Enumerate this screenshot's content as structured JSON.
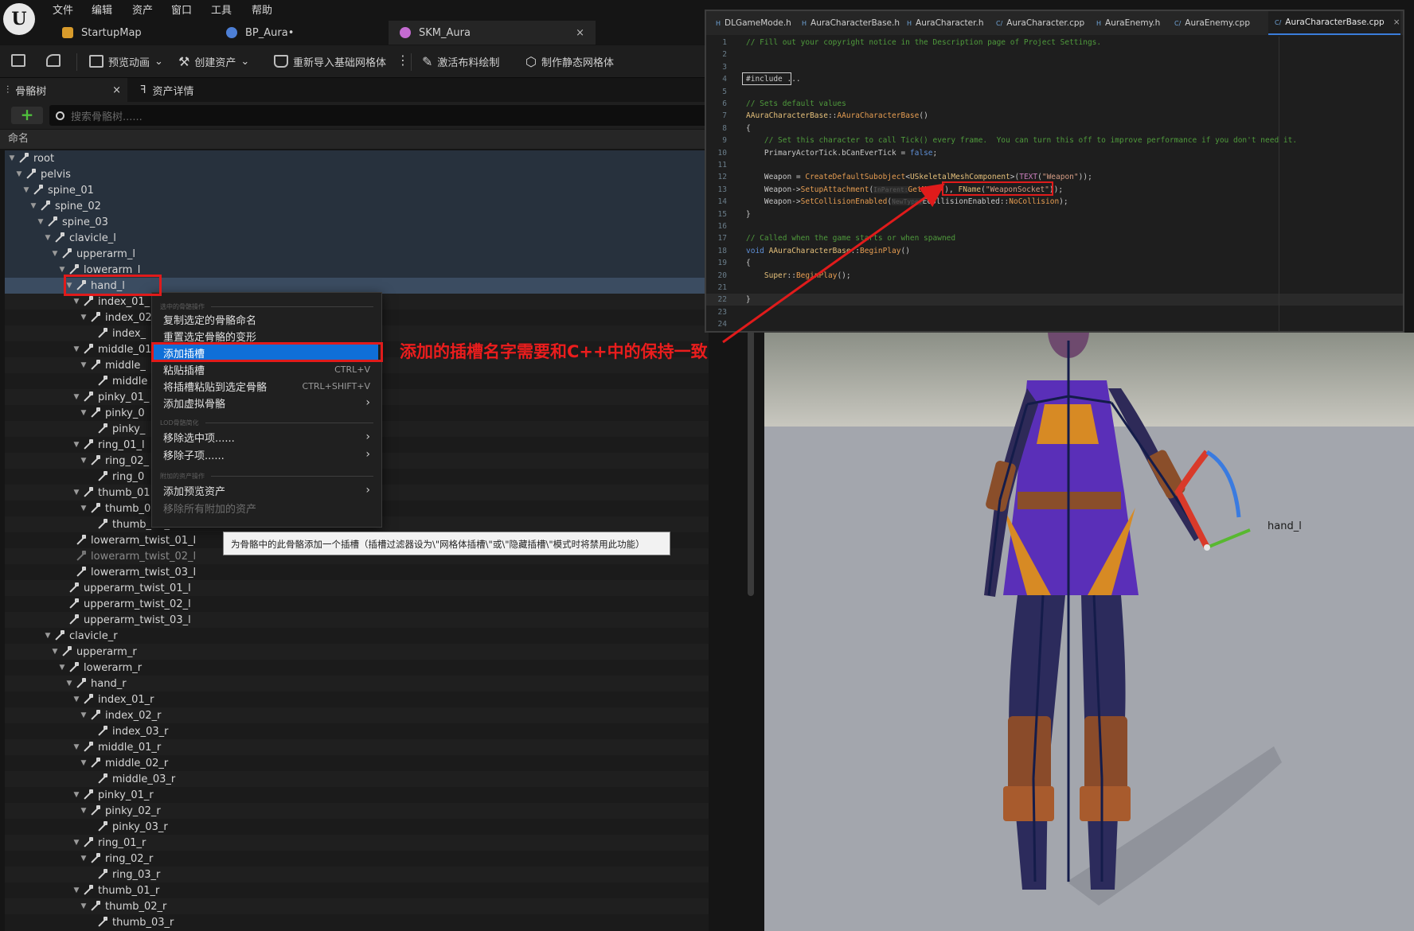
{
  "menu": [
    "文件",
    "编辑",
    "资产",
    "窗口",
    "工具",
    "帮助"
  ],
  "doc_tabs": [
    {
      "label": "StartupMap",
      "color": "#d89b2b"
    },
    {
      "label": "BP_Aura•",
      "color": "#4d7fd6"
    },
    {
      "label": "SKM_Aura",
      "color": "#c46bd1",
      "close": "×"
    }
  ],
  "toolbar": {
    "preview_animation": "预览动画",
    "create_asset": "创建资产",
    "reimport_base_mesh": "重新导入基础网格体",
    "activate_cloth_paint": "激活布料绘制",
    "make_static_mesh": "制作静态网格体"
  },
  "panel": {
    "tab_skeleton_tree": "骨骼树",
    "tab_asset_details": "资产详情",
    "tab_close": "×",
    "add_label": "+",
    "search_placeholder": "搜索骨骼树......",
    "column_header": "命名"
  },
  "tree": [
    {
      "label": "root",
      "tri": "▼"
    },
    {
      "label": "pelvis",
      "tri": "▼"
    },
    {
      "label": "spine_01",
      "tri": "▼"
    },
    {
      "label": "spine_02",
      "tri": "▼"
    },
    {
      "label": "spine_03",
      "tri": "▼"
    },
    {
      "label": "clavicle_l",
      "tri": "▼"
    },
    {
      "label": "upperarm_l",
      "tri": "▼"
    },
    {
      "label": "lowerarm_l",
      "tri": "▼"
    },
    {
      "label": "hand_l",
      "tri": "▼"
    },
    {
      "label": "index_01_",
      "tri": "▼"
    },
    {
      "label": "index_02",
      "tri": "▼"
    },
    {
      "label": "index_",
      "tri": ""
    },
    {
      "label": "middle_01",
      "tri": "▼"
    },
    {
      "label": "middle_",
      "tri": "▼"
    },
    {
      "label": "middle",
      "tri": ""
    },
    {
      "label": "pinky_01_",
      "tri": "▼"
    },
    {
      "label": "pinky_0",
      "tri": "▼"
    },
    {
      "label": "pinky_",
      "tri": ""
    },
    {
      "label": "ring_01_l",
      "tri": "▼"
    },
    {
      "label": "ring_02_",
      "tri": "▼"
    },
    {
      "label": "ring_0",
      "tri": ""
    },
    {
      "label": "thumb_01",
      "tri": "▼"
    },
    {
      "label": "thumb_0",
      "tri": "▼"
    },
    {
      "label": "thumb_03_",
      "tri": ""
    },
    {
      "label": "lowerarm_twist_01_l",
      "tri": ""
    },
    {
      "label": "lowerarm_twist_02_l",
      "tri": ""
    },
    {
      "label": "lowerarm_twist_03_l",
      "tri": ""
    },
    {
      "label": "upperarm_twist_01_l",
      "tri": ""
    },
    {
      "label": "upperarm_twist_02_l",
      "tri": ""
    },
    {
      "label": "upperarm_twist_03_l",
      "tri": ""
    },
    {
      "label": "clavicle_r",
      "tri": "▼"
    },
    {
      "label": "upperarm_r",
      "tri": "▼"
    },
    {
      "label": "lowerarm_r",
      "tri": "▼"
    },
    {
      "label": "hand_r",
      "tri": "▼"
    },
    {
      "label": "index_01_r",
      "tri": "▼"
    },
    {
      "label": "index_02_r",
      "tri": "▼"
    },
    {
      "label": "index_03_r",
      "tri": ""
    },
    {
      "label": "middle_01_r",
      "tri": "▼"
    },
    {
      "label": "middle_02_r",
      "tri": "▼"
    },
    {
      "label": "middle_03_r",
      "tri": ""
    },
    {
      "label": "pinky_01_r",
      "tri": "▼"
    },
    {
      "label": "pinky_02_r",
      "tri": "▼"
    },
    {
      "label": "pinky_03_r",
      "tri": ""
    },
    {
      "label": "ring_01_r",
      "tri": "▼"
    },
    {
      "label": "ring_02_r",
      "tri": "▼"
    },
    {
      "label": "ring_03_r",
      "tri": ""
    },
    {
      "label": "thumb_01_r",
      "tri": "▼"
    },
    {
      "label": "thumb_02_r",
      "tri": "▼"
    },
    {
      "label": "thumb_03_r",
      "tri": ""
    }
  ],
  "context_menu": {
    "section_selected": "选中的骨骼操作",
    "copy_bone_names": "复制选定的骨骼命名",
    "reset_transforms": "重置选定骨骼的变形",
    "add_socket": "添加插槽",
    "paste_socket": "粘贴插槽",
    "paste_socket_shortcut": "CTRL+V",
    "paste_socket_to_bone": "将插槽粘贴到选定骨骼",
    "paste_socket_to_bone_shortcut": "CTRL+SHIFT+V",
    "add_virtual_bone": "添加虚拟骨骼",
    "section_lod": "LOD骨骼简化",
    "remove_selected": "移除选中项......",
    "remove_children": "移除子项......",
    "section_attached": "附加的资产操作",
    "add_preview_asset": "添加预览资产",
    "remove_all_attached": "移除所有附加的资产",
    "arrow": "›"
  },
  "tooltip": "为骨骼中的此骨骼添加一个插槽（插槽过滤器设为\\\"网格体插槽\\\"或\\\"隐藏插槽\\\"模式时将禁用此功能）",
  "annotation": "添加的插槽名字需要和C++中的保持一致",
  "editor": {
    "tabs": [
      {
        "label": "DLGameMode.h",
        "ext": "H"
      },
      {
        "label": "AuraCharacterBase.h",
        "ext": "H"
      },
      {
        "label": "AuraCharacter.h",
        "ext": "H"
      },
      {
        "label": "AuraCharacter.cpp",
        "ext": "C/"
      },
      {
        "label": "AuraEnemy.h",
        "ext": "H"
      },
      {
        "label": "AuraEnemy.cpp",
        "ext": "C/"
      },
      {
        "label": "AuraCharacterBase.cpp",
        "ext": "C/",
        "close": "×"
      }
    ],
    "lines": [
      {
        "n": "1",
        "parts": [
          {
            "c": "c-com",
            "t": "// Fill out your copyright notice in the Description page of Project Settings."
          }
        ]
      },
      {
        "n": "2",
        "parts": []
      },
      {
        "n": "3",
        "parts": []
      },
      {
        "n": "4",
        "parts": [
          {
            "c": "c-plain",
            "t": "#include ..."
          }
        ]
      },
      {
        "n": "5",
        "parts": []
      },
      {
        "n": "6",
        "parts": [
          {
            "c": "c-com",
            "t": "// Sets default values"
          }
        ]
      },
      {
        "n": "7",
        "parts": [
          {
            "c": "c-type",
            "t": "AAuraCharacterBase"
          },
          {
            "c": "c-plain",
            "t": "::"
          },
          {
            "c": "c-fn",
            "t": "AAuraCharacterBase"
          },
          {
            "c": "c-plain",
            "t": "()"
          }
        ]
      },
      {
        "n": "8",
        "parts": [
          {
            "c": "c-plain",
            "t": "{"
          }
        ]
      },
      {
        "n": "9",
        "parts": [
          {
            "c": "c-com",
            "t": "    // Set this character to call Tick() every frame.  You can turn this off to improve performance if you don't need it."
          }
        ]
      },
      {
        "n": "10",
        "parts": [
          {
            "c": "c-plain",
            "t": "    PrimaryActorTick.bCanEverTick = "
          },
          {
            "c": "c-kw",
            "t": "false"
          },
          {
            "c": "c-plain",
            "t": ";"
          }
        ]
      },
      {
        "n": "11",
        "parts": []
      },
      {
        "n": "12",
        "parts": [
          {
            "c": "c-plain",
            "t": "    Weapon = "
          },
          {
            "c": "c-fn",
            "t": "CreateDefaultSubobject"
          },
          {
            "c": "c-plain",
            "t": "<"
          },
          {
            "c": "c-type",
            "t": "USkeletalMeshComponent"
          },
          {
            "c": "c-plain",
            "t": ">("
          },
          {
            "c": "c-mac",
            "t": "TEXT"
          },
          {
            "c": "c-plain",
            "t": "("
          },
          {
            "c": "c-str",
            "t": "\"Weapon\""
          },
          {
            "c": "c-plain",
            "t": "));"
          }
        ]
      },
      {
        "n": "13",
        "parts": [
          {
            "c": "c-plain",
            "t": "    Weapon->"
          },
          {
            "c": "c-fn",
            "t": "SetupAttachment"
          },
          {
            "c": "c-plain",
            "t": "("
          },
          {
            "c": "c-ph",
            "t": "InParent:"
          },
          {
            "c": "c-fn",
            "t": "GetMesh"
          },
          {
            "c": "c-plain",
            "t": "(), "
          },
          {
            "c": "c-type",
            "t": "FName"
          },
          {
            "c": "c-plain",
            "t": "("
          },
          {
            "c": "c-str",
            "t": "\"WeaponSocket\""
          },
          {
            "c": "c-plain",
            "t": "));"
          }
        ]
      },
      {
        "n": "14",
        "parts": [
          {
            "c": "c-plain",
            "t": "    Weapon->"
          },
          {
            "c": "c-fn",
            "t": "SetCollisionEnabled"
          },
          {
            "c": "c-plain",
            "t": "("
          },
          {
            "c": "c-ph",
            "t": "NewType:"
          },
          {
            "c": "c-plain",
            "t": "ECollisionEnabled::"
          },
          {
            "c": "c-fn",
            "t": "NoCollision"
          },
          {
            "c": "c-plain",
            "t": ");"
          }
        ]
      },
      {
        "n": "15",
        "parts": [
          {
            "c": "c-plain",
            "t": "}"
          }
        ]
      },
      {
        "n": "16",
        "parts": []
      },
      {
        "n": "17",
        "parts": [
          {
            "c": "c-com",
            "t": "// Called when the game starts or when spawned"
          }
        ]
      },
      {
        "n": "18",
        "parts": [
          {
            "c": "c-kw",
            "t": "void "
          },
          {
            "c": "c-type",
            "t": "AAuraCharacterBase"
          },
          {
            "c": "c-plain",
            "t": "::"
          },
          {
            "c": "c-fn",
            "t": "BeginPlay"
          },
          {
            "c": "c-plain",
            "t": "()"
          }
        ]
      },
      {
        "n": "19",
        "parts": [
          {
            "c": "c-plain",
            "t": "{"
          }
        ]
      },
      {
        "n": "20",
        "parts": [
          {
            "c": "c-plain",
            "t": "    "
          },
          {
            "c": "c-type",
            "t": "Super"
          },
          {
            "c": "c-plain",
            "t": "::"
          },
          {
            "c": "c-fn",
            "t": "BeginPlay"
          },
          {
            "c": "c-plain",
            "t": "();"
          }
        ]
      },
      {
        "n": "21",
        "parts": []
      },
      {
        "n": "22",
        "parts": [
          {
            "c": "c-plain",
            "t": "}"
          }
        ]
      },
      {
        "n": "23",
        "parts": []
      },
      {
        "n": "24",
        "parts": []
      }
    ]
  },
  "viewport": {
    "socket_label": "hand_l"
  },
  "colors": {
    "annotation_red": "#e01b1b",
    "menu_highlight": "#0f6fd8",
    "selection": "#3b4c61"
  }
}
